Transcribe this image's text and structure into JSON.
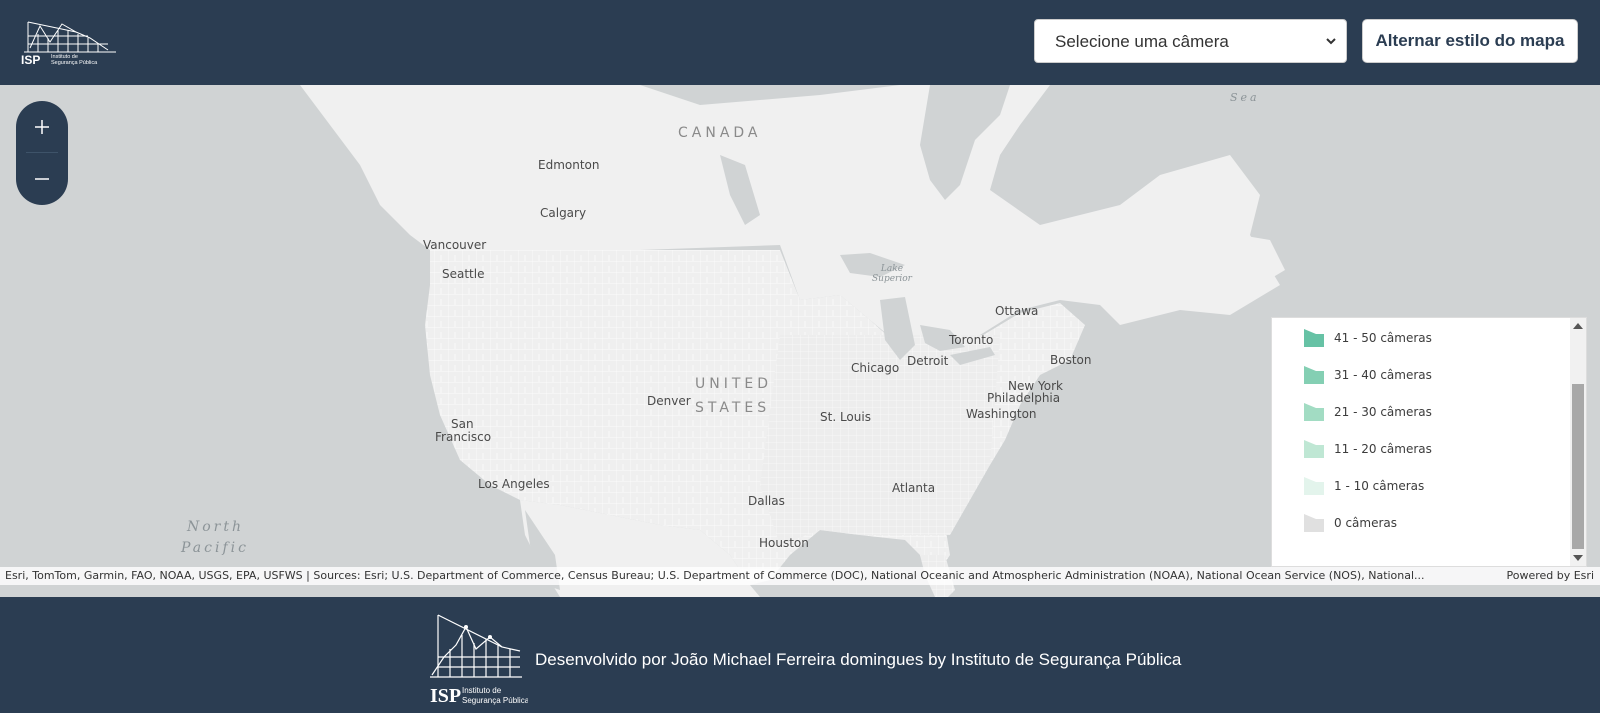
{
  "header": {
    "logo_text": "ISP",
    "logo_subtext_1": "Instituto de",
    "logo_subtext_2": "Segurança Pública",
    "camera_select_value": "Selecione uma câmera",
    "toggle_map_style_label": "Alternar estilo do mapa"
  },
  "map": {
    "zoom_in_label": "+",
    "zoom_out_label": "—",
    "labels": {
      "canada": "CANADA",
      "united": "UNITED",
      "states": "STATES",
      "north_pacific_1": "North",
      "north_pacific_2": "Pacific",
      "sea": "Sea",
      "lake_superior_1": "Lake",
      "lake_superior_2": "Superior",
      "edmonton": "Edmonton",
      "calgary": "Calgary",
      "vancouver": "Vancouver",
      "seattle": "Seattle",
      "ottawa": "Ottawa",
      "toronto": "Toronto",
      "detroit": "Detroit",
      "chicago": "Chicago",
      "boston": "Boston",
      "new_york": "New York",
      "philadelphia": "Philadelphia",
      "washington": "Washington",
      "denver": "Denver",
      "st_louis": "St. Louis",
      "san_francisco_1": "San",
      "san_francisco_2": "Francisco",
      "los_angeles": "Los Angeles",
      "dallas": "Dallas",
      "atlanta": "Atlanta",
      "houston": "Houston"
    },
    "legend": {
      "items": [
        {
          "label": "41 - 50 câmeras",
          "color": "#66c2a5"
        },
        {
          "label": "31 - 40 câmeras",
          "color": "#84cfb3"
        },
        {
          "label": "21 - 30 câmeras",
          "color": "#a2dcc3"
        },
        {
          "label": "11 - 20 câmeras",
          "color": "#bfe7d4"
        },
        {
          "label": "1 - 10 câmeras",
          "color": "#e3f4ec"
        },
        {
          "label": "0 câmeras",
          "color": "#e0e0e0"
        }
      ]
    },
    "attribution": "Esri, TomTom, Garmin, FAO, NOAA, USGS, EPA, USFWS | Sources: Esri; U.S. Department of Commerce, Census Bureau; U.S. Department of Commerce (DOC), National Oceanic and Atmospheric Administration (NOAA), National Ocean Service (NOS), National...",
    "powered_by": "Powered by Esri"
  },
  "footer": {
    "text": "Desenvolvido por João Michael Ferreira domingues by Instituto de Segurança Pública",
    "logo_text": "ISP",
    "logo_subtext_1": "Instituto de",
    "logo_subtext_2": "Segurança Pública"
  },
  "colors": {
    "header_bg": "#2b3d52",
    "water": "#d0d3d4",
    "land": "#f0f0f0",
    "county_lines": "#ffffff"
  }
}
